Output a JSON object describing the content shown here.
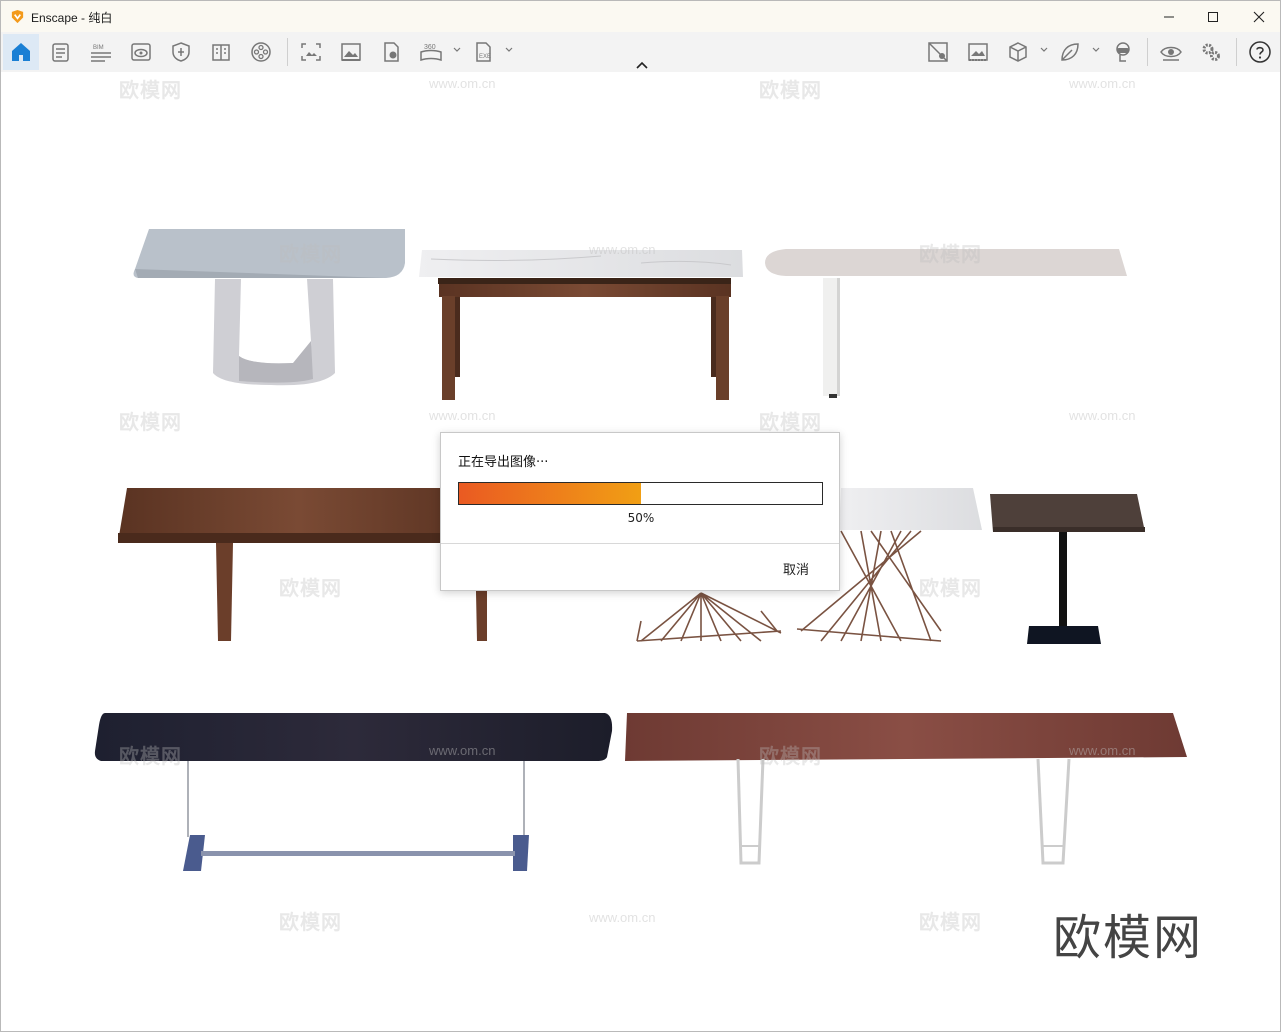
{
  "window": {
    "title": "Enscape - 纯白"
  },
  "toolbar": {
    "left_icons": [
      "home-icon",
      "document-icon",
      "bim-icon",
      "view-icon",
      "shield-icon",
      "book-icon",
      "film-reel-icon",
      "screenshot-icon",
      "image-icon",
      "render-icon",
      "panorama-360-icon",
      "exe-export-icon"
    ],
    "bim_label": "BIM",
    "pano_label": "360",
    "exe_label": "EXE",
    "right_icons": [
      "map-icon",
      "image-settings-icon",
      "cube-icon",
      "leaf-icon",
      "vr-headset-icon",
      "eye-icon",
      "settings-icon",
      "help-icon"
    ]
  },
  "dialog": {
    "title": "正在导出图像···",
    "progress": 0.5,
    "progress_label": "50%",
    "cancel_label": "取消"
  },
  "watermark": {
    "brand": "欧模网",
    "url": "www.om.cn"
  },
  "colors": {
    "accent": "#1a7fd4",
    "progress_start": "#ea5a22",
    "progress_end": "#f19f14"
  }
}
